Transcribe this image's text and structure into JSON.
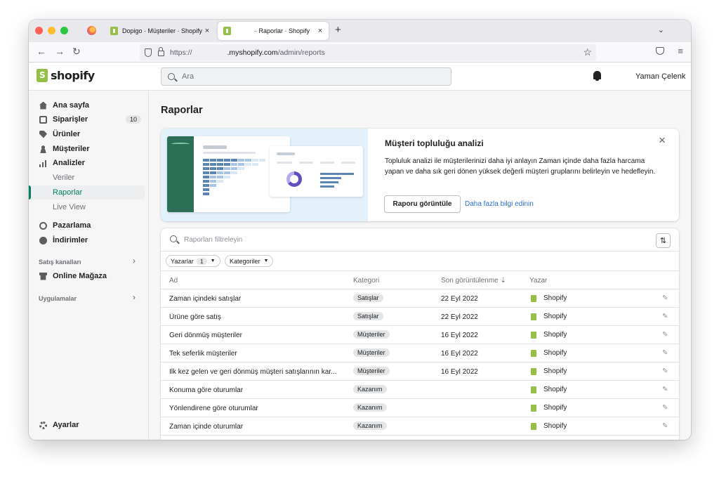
{
  "browser": {
    "tabs": [
      {
        "label": "Dopigo · Müşteriler · Shopify",
        "close": "×"
      },
      {
        "label": "· Raporlar · Shopify",
        "close": "×"
      }
    ],
    "new_tab": "+",
    "tabs_dropdown": "⌄",
    "back": "←",
    "forward": "→",
    "reload": "↻",
    "url_protocol": "https://",
    "url_host": ".myshopify.com",
    "url_path": "/admin/reports",
    "star": "☆",
    "menu": "≡"
  },
  "topbar": {
    "brand": "shopify",
    "search_placeholder": "Ara",
    "user_name": "Yaman Çelenk"
  },
  "sidebar": {
    "items": [
      {
        "label": "Ana sayfa"
      },
      {
        "label": "Siparişler",
        "badge": "10"
      },
      {
        "label": "Ürünler"
      },
      {
        "label": "Müşteriler"
      },
      {
        "label": "Analizler"
      },
      {
        "label": "Veriler"
      },
      {
        "label": "Raporlar"
      },
      {
        "label": "Live View"
      },
      {
        "label": "Pazarlama"
      },
      {
        "label": "İndirimler"
      }
    ],
    "sales_channels": "Satış kanalları",
    "online_store": "Online Mağaza",
    "apps": "Uygulamalar",
    "settings": "Ayarlar",
    "arrow": "›"
  },
  "main": {
    "title": "Raporlar",
    "banner": {
      "title": "Müşteri topluluğu analizi",
      "description": "Topluluk analizi ile müşterilerinizi daha iyi anlayın Zaman içinde daha fazla harcama yapan ve daha sık geri dönen yüksek değerli müşteri gruplarını belirleyin ve hedefleyin.",
      "button": "Raporu görüntüle",
      "link": "Daha fazla bilgi edinin",
      "close": "×"
    },
    "filter_placeholder": "Raporları filtreleyin",
    "sort_icon": "⇅",
    "chips": [
      {
        "label": "Yazarlar",
        "count": "1"
      },
      {
        "label": "Kategoriler"
      }
    ],
    "columns": {
      "name": "Ad",
      "category": "Kategori",
      "last_viewed": "Son görüntülenme ⇣",
      "author": "Yazar"
    },
    "rows": [
      {
        "name": "Zaman içindeki satışlar",
        "category": "Satışlar",
        "date": "22 Eyl 2022",
        "author": "Shopify"
      },
      {
        "name": "Ürüne göre satış",
        "category": "Satışlar",
        "date": "22 Eyl 2022",
        "author": "Shopify"
      },
      {
        "name": "Geri dönmüş müşteriler",
        "category": "Müşteriler",
        "date": "16 Eyl 2022",
        "author": "Shopify"
      },
      {
        "name": "Tek seferlik müşteriler",
        "category": "Müşteriler",
        "date": "16 Eyl 2022",
        "author": "Shopify"
      },
      {
        "name": "İlk kez gelen ve geri dönmüş müşteri satışlarının kar...",
        "category": "Müşteriler",
        "date": "16 Eyl 2022",
        "author": "Shopify"
      },
      {
        "name": "Konuma göre oturumlar",
        "category": "Kazanım",
        "date": "",
        "author": "Shopify"
      },
      {
        "name": "Yönlendirene göre oturumlar",
        "category": "Kazanım",
        "date": "",
        "author": "Shopify"
      },
      {
        "name": "Zaman içinde oturumlar",
        "category": "Kazanım",
        "date": "",
        "author": "Shopify"
      }
    ],
    "pin_icon": "✎"
  },
  "colors": {
    "accent": "#008060",
    "link": "#2c6ecb",
    "brand": "#95bf47"
  }
}
